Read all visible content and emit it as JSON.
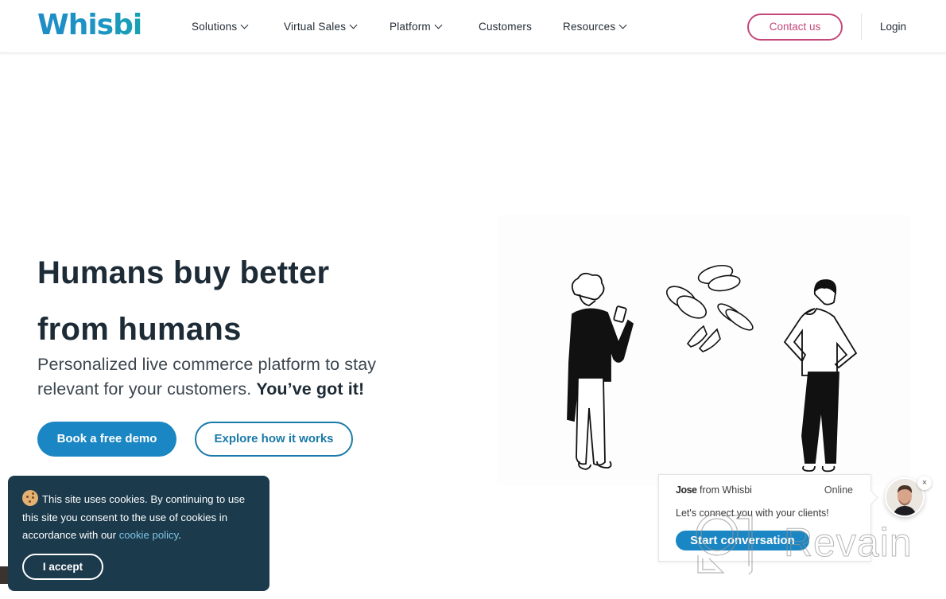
{
  "brand": {
    "logo_text": "Whisbi",
    "primary_color": "#1a86c3",
    "accent_color": "#c4477a",
    "dark_color": "#1b3a4c"
  },
  "nav": {
    "items": [
      {
        "label": "Solutions",
        "has_dropdown": true
      },
      {
        "label": "Virtual Sales",
        "has_dropdown": true
      },
      {
        "label": "Platform",
        "has_dropdown": true
      },
      {
        "label": "Customers",
        "has_dropdown": false
      },
      {
        "label": "Resources",
        "has_dropdown": true
      }
    ],
    "contact_label": "Contact us",
    "login_label": "Login"
  },
  "hero": {
    "title_line1": "Humans buy better",
    "title_line2": "from humans",
    "subtitle": "Personalized live commerce platform to stay relevant for your customers.",
    "subtitle_emphasis": "You’ve got it!",
    "primary_cta": "Book a free demo",
    "secondary_cta": "Explore how it works",
    "illustration": "woman-with-phone-shoes-man-illustration"
  },
  "cookie_banner": {
    "icon": "cookie-icon",
    "text": "This site uses cookies. By continuing to use this site you consent to the use of cookies in accordance with our",
    "link_text": "cookie policy",
    "trailing": ".",
    "accept_label": "I accept"
  },
  "chat_widget": {
    "agent_name": "Jose",
    "agent_from": "from Whisbi",
    "status": "Online",
    "message": "Let's connect you with your clients!",
    "cta": "Start conversation",
    "close_icon": "×"
  },
  "watermark": {
    "text": "Revain"
  }
}
